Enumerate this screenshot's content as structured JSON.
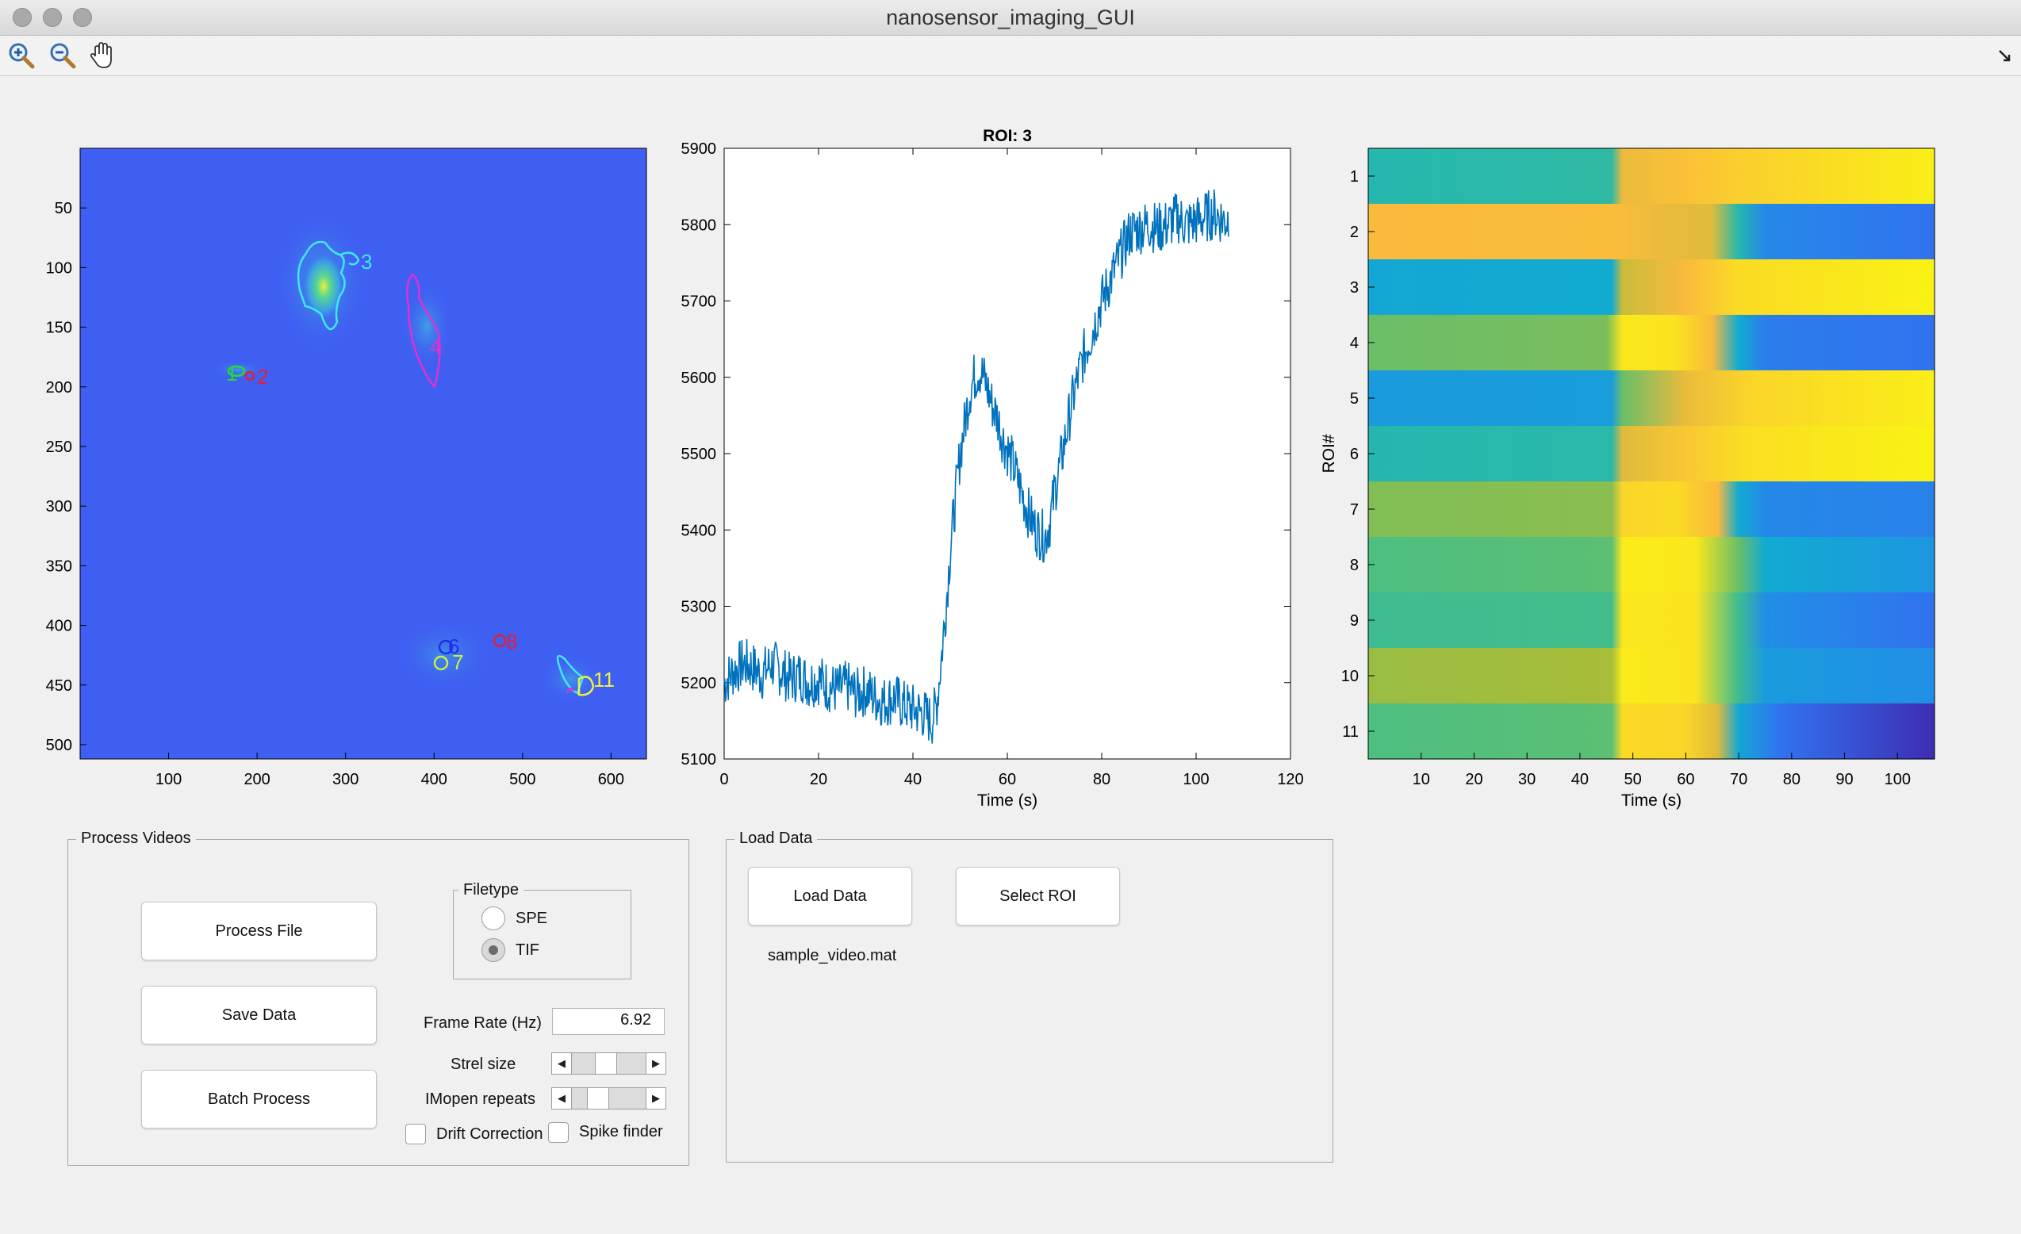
{
  "window": {
    "title": "nanosensor_imaging_GUI"
  },
  "toolbar": [
    {
      "name": "zoom-in-icon"
    },
    {
      "name": "zoom-out-icon"
    },
    {
      "name": "pan-hand-icon"
    }
  ],
  "image_axes": {
    "x_ticks": [
      "100",
      "200",
      "300",
      "400",
      "500",
      "600"
    ],
    "y_ticks": [
      "50",
      "100",
      "150",
      "200",
      "250",
      "300",
      "350",
      "400",
      "450",
      "500"
    ],
    "roi_labels": [
      {
        "text": "1",
        "color": "#27d93a"
      },
      {
        "text": "2",
        "color": "#e0203a"
      },
      {
        "text": "3",
        "color": "#40e8f0"
      },
      {
        "text": "4",
        "color": "#e030d0"
      },
      {
        "text": "6",
        "color": "#2030e8"
      },
      {
        "text": "7",
        "color": "#c8f040"
      },
      {
        "text": "8",
        "color": "#e0203a"
      },
      {
        "text": "11",
        "color": "#f0f040"
      }
    ]
  },
  "chart_data": [
    {
      "type": "line",
      "title": "ROI: 3",
      "xlabel": "Time (s)",
      "ylabel": "",
      "xlim": [
        0,
        120
      ],
      "ylim": [
        5100,
        5900
      ],
      "x_ticks": [
        0,
        20,
        40,
        60,
        80,
        100,
        120
      ],
      "y_ticks": [
        5100,
        5200,
        5300,
        5400,
        5500,
        5600,
        5700,
        5800,
        5900
      ],
      "grid": false,
      "color": "#0072bd",
      "series": [
        {
          "x": [
            0,
            2,
            4,
            6,
            8,
            10,
            12,
            14,
            16,
            18,
            20,
            22,
            24,
            26,
            28,
            30,
            32,
            34,
            36,
            38,
            40,
            42,
            44,
            45,
            46,
            47,
            48,
            49,
            50,
            51,
            52,
            53,
            54,
            55,
            56,
            57,
            58,
            59,
            60,
            61,
            62,
            63,
            64,
            65,
            66,
            67,
            68,
            69,
            70,
            71,
            72,
            73,
            74,
            75,
            76,
            78,
            80,
            82,
            84,
            86,
            88,
            90,
            92,
            94,
            96,
            98,
            100,
            102,
            104,
            106,
            107
          ],
          "y": [
            5200,
            5215,
            5225,
            5220,
            5210,
            5225,
            5215,
            5205,
            5210,
            5200,
            5205,
            5195,
            5190,
            5195,
            5185,
            5190,
            5180,
            5175,
            5180,
            5170,
            5165,
            5160,
            5150,
            5170,
            5230,
            5300,
            5380,
            5440,
            5500,
            5540,
            5580,
            5600,
            5610,
            5600,
            5580,
            5560,
            5545,
            5520,
            5505,
            5490,
            5470,
            5450,
            5430,
            5415,
            5400,
            5395,
            5390,
            5410,
            5450,
            5480,
            5510,
            5545,
            5575,
            5600,
            5625,
            5660,
            5700,
            5730,
            5760,
            5790,
            5795,
            5800,
            5795,
            5800,
            5810,
            5800,
            5805,
            5810,
            5815,
            5805,
            5810
          ]
        }
      ]
    },
    {
      "type": "heatmap",
      "title": "",
      "xlabel": "Time (s)",
      "ylabel": "ROI#",
      "x_ticks": [
        10,
        20,
        30,
        40,
        50,
        60,
        70,
        80,
        90,
        100
      ],
      "xlim": [
        0,
        107
      ],
      "rows": [
        "1",
        "2",
        "3",
        "4",
        "5",
        "6",
        "7",
        "8",
        "9",
        "10",
        "11"
      ],
      "colormap": "parula",
      "stops": [
        [
          [
            0,
            0.5
          ],
          [
            46,
            0.52
          ],
          [
            48,
            0.8
          ],
          [
            60,
            0.84
          ],
          [
            70,
            0.88
          ],
          [
            85,
            0.92
          ],
          [
            107,
            0.97
          ]
        ],
        [
          [
            0,
            0.82
          ],
          [
            46,
            0.83
          ],
          [
            55,
            0.8
          ],
          [
            65,
            0.78
          ],
          [
            70,
            0.5
          ],
          [
            75,
            0.28
          ],
          [
            107,
            0.22
          ]
        ],
        [
          [
            0,
            0.4
          ],
          [
            46,
            0.42
          ],
          [
            48,
            0.75
          ],
          [
            60,
            0.82
          ],
          [
            70,
            0.92
          ],
          [
            107,
            0.98
          ]
        ],
        [
          [
            0,
            0.62
          ],
          [
            45,
            0.64
          ],
          [
            48,
            0.95
          ],
          [
            58,
            0.94
          ],
          [
            65,
            0.82
          ],
          [
            70,
            0.42
          ],
          [
            75,
            0.25
          ],
          [
            107,
            0.22
          ]
        ],
        [
          [
            0,
            0.35
          ],
          [
            46,
            0.36
          ],
          [
            48,
            0.62
          ],
          [
            60,
            0.8
          ],
          [
            72,
            0.9
          ],
          [
            107,
            0.97
          ]
        ],
        [
          [
            0,
            0.5
          ],
          [
            46,
            0.51
          ],
          [
            48,
            0.78
          ],
          [
            60,
            0.86
          ],
          [
            72,
            0.93
          ],
          [
            107,
            0.98
          ]
        ],
        [
          [
            0,
            0.65
          ],
          [
            46,
            0.66
          ],
          [
            48,
            0.9
          ],
          [
            58,
            0.92
          ],
          [
            66,
            0.82
          ],
          [
            70,
            0.42
          ],
          [
            75,
            0.28
          ],
          [
            107,
            0.26
          ]
        ],
        [
          [
            0,
            0.58
          ],
          [
            46,
            0.6
          ],
          [
            48,
            0.96
          ],
          [
            62,
            0.95
          ],
          [
            70,
            0.62
          ],
          [
            75,
            0.42
          ],
          [
            107,
            0.33
          ]
        ],
        [
          [
            0,
            0.55
          ],
          [
            46,
            0.56
          ],
          [
            48,
            0.95
          ],
          [
            62,
            0.94
          ],
          [
            70,
            0.55
          ],
          [
            75,
            0.3
          ],
          [
            107,
            0.22
          ]
        ],
        [
          [
            0,
            0.68
          ],
          [
            46,
            0.7
          ],
          [
            48,
            0.96
          ],
          [
            62,
            0.94
          ],
          [
            70,
            0.55
          ],
          [
            75,
            0.35
          ],
          [
            107,
            0.3
          ]
        ],
        [
          [
            0,
            0.58
          ],
          [
            46,
            0.6
          ],
          [
            48,
            0.92
          ],
          [
            60,
            0.9
          ],
          [
            66,
            0.78
          ],
          [
            70,
            0.4
          ],
          [
            78,
            0.22
          ],
          [
            107,
            0.02
          ]
        ]
      ]
    }
  ],
  "process_videos": {
    "title": "Process Videos",
    "process_file": "Process File",
    "save_data": "Save Data",
    "batch_process": "Batch Process",
    "filetype_title": "Filetype",
    "filetype_options": [
      "SPE",
      "TIF"
    ],
    "filetype_selected": "TIF",
    "frame_rate_label": "Frame Rate (Hz)",
    "frame_rate_value": "6.92",
    "strel_label": "Strel size",
    "strel_value": 0.45,
    "imopen_label": "IMopen repeats",
    "imopen_value": 0.3,
    "drift_label": "Drift Correction",
    "drift_checked": false,
    "spike_label": "Spike finder",
    "spike_checked": false
  },
  "load_data": {
    "title": "Load Data",
    "load_button": "Load Data",
    "select_roi": "Select ROI",
    "filename": "sample_video.mat"
  }
}
